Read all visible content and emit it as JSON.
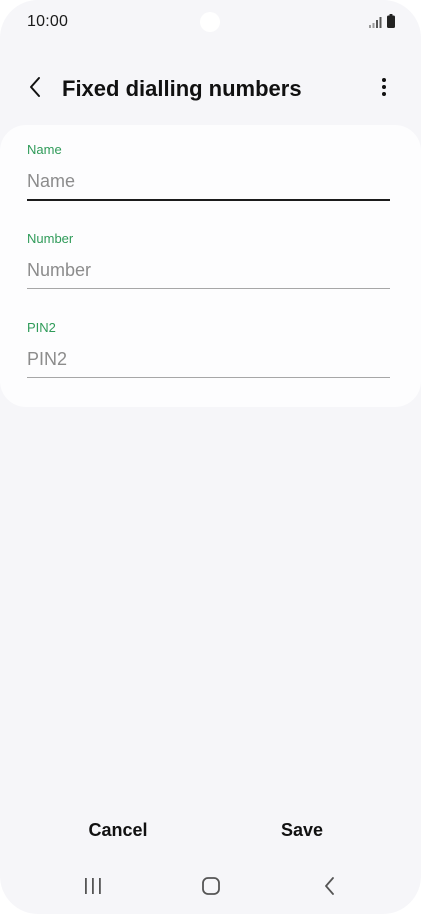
{
  "status_bar": {
    "time": "10:00",
    "icons": [
      "signal-icon",
      "battery-icon"
    ]
  },
  "header": {
    "title": "Fixed dialling numbers",
    "back_icon": "chevron-left-icon",
    "more_icon": "more-vertical-icon"
  },
  "form": {
    "fields": [
      {
        "label": "Name",
        "placeholder": "Name",
        "value": "",
        "focused": true
      },
      {
        "label": "Number",
        "placeholder": "Number",
        "value": "",
        "focused": false
      },
      {
        "label": "PIN2",
        "placeholder": "PIN2",
        "value": "",
        "focused": false
      }
    ]
  },
  "actions": {
    "cancel_label": "Cancel",
    "save_label": "Save"
  },
  "nav_bar": {
    "icons": [
      "recents-icon",
      "home-icon",
      "back-icon"
    ]
  },
  "colors": {
    "accent": "#2f9b59",
    "background": "#f6f6f9",
    "card": "#fdfdfe",
    "text": "#111111",
    "placeholder": "#8c8c8c"
  }
}
